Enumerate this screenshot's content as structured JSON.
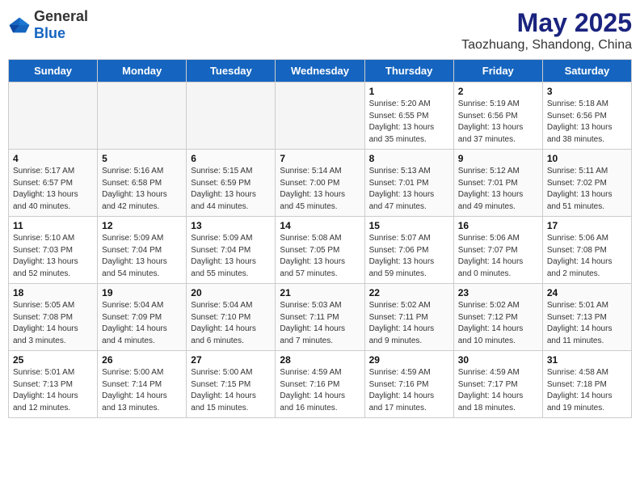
{
  "header": {
    "logo_general": "General",
    "logo_blue": "Blue",
    "title": "May 2025",
    "subtitle": "Taozhuang, Shandong, China"
  },
  "days_of_week": [
    "Sunday",
    "Monday",
    "Tuesday",
    "Wednesday",
    "Thursday",
    "Friday",
    "Saturday"
  ],
  "weeks": [
    [
      {
        "day": "",
        "empty": true
      },
      {
        "day": "",
        "empty": true
      },
      {
        "day": "",
        "empty": true
      },
      {
        "day": "",
        "empty": true
      },
      {
        "day": "1",
        "sunrise": "Sunrise: 5:20 AM",
        "sunset": "Sunset: 6:55 PM",
        "daylight": "Daylight: 13 hours and 35 minutes."
      },
      {
        "day": "2",
        "sunrise": "Sunrise: 5:19 AM",
        "sunset": "Sunset: 6:56 PM",
        "daylight": "Daylight: 13 hours and 37 minutes."
      },
      {
        "day": "3",
        "sunrise": "Sunrise: 5:18 AM",
        "sunset": "Sunset: 6:56 PM",
        "daylight": "Daylight: 13 hours and 38 minutes."
      }
    ],
    [
      {
        "day": "4",
        "sunrise": "Sunrise: 5:17 AM",
        "sunset": "Sunset: 6:57 PM",
        "daylight": "Daylight: 13 hours and 40 minutes."
      },
      {
        "day": "5",
        "sunrise": "Sunrise: 5:16 AM",
        "sunset": "Sunset: 6:58 PM",
        "daylight": "Daylight: 13 hours and 42 minutes."
      },
      {
        "day": "6",
        "sunrise": "Sunrise: 5:15 AM",
        "sunset": "Sunset: 6:59 PM",
        "daylight": "Daylight: 13 hours and 44 minutes."
      },
      {
        "day": "7",
        "sunrise": "Sunrise: 5:14 AM",
        "sunset": "Sunset: 7:00 PM",
        "daylight": "Daylight: 13 hours and 45 minutes."
      },
      {
        "day": "8",
        "sunrise": "Sunrise: 5:13 AM",
        "sunset": "Sunset: 7:01 PM",
        "daylight": "Daylight: 13 hours and 47 minutes."
      },
      {
        "day": "9",
        "sunrise": "Sunrise: 5:12 AM",
        "sunset": "Sunset: 7:01 PM",
        "daylight": "Daylight: 13 hours and 49 minutes."
      },
      {
        "day": "10",
        "sunrise": "Sunrise: 5:11 AM",
        "sunset": "Sunset: 7:02 PM",
        "daylight": "Daylight: 13 hours and 51 minutes."
      }
    ],
    [
      {
        "day": "11",
        "sunrise": "Sunrise: 5:10 AM",
        "sunset": "Sunset: 7:03 PM",
        "daylight": "Daylight: 13 hours and 52 minutes."
      },
      {
        "day": "12",
        "sunrise": "Sunrise: 5:09 AM",
        "sunset": "Sunset: 7:04 PM",
        "daylight": "Daylight: 13 hours and 54 minutes."
      },
      {
        "day": "13",
        "sunrise": "Sunrise: 5:09 AM",
        "sunset": "Sunset: 7:04 PM",
        "daylight": "Daylight: 13 hours and 55 minutes."
      },
      {
        "day": "14",
        "sunrise": "Sunrise: 5:08 AM",
        "sunset": "Sunset: 7:05 PM",
        "daylight": "Daylight: 13 hours and 57 minutes."
      },
      {
        "day": "15",
        "sunrise": "Sunrise: 5:07 AM",
        "sunset": "Sunset: 7:06 PM",
        "daylight": "Daylight: 13 hours and 59 minutes."
      },
      {
        "day": "16",
        "sunrise": "Sunrise: 5:06 AM",
        "sunset": "Sunset: 7:07 PM",
        "daylight": "Daylight: 14 hours and 0 minutes."
      },
      {
        "day": "17",
        "sunrise": "Sunrise: 5:06 AM",
        "sunset": "Sunset: 7:08 PM",
        "daylight": "Daylight: 14 hours and 2 minutes."
      }
    ],
    [
      {
        "day": "18",
        "sunrise": "Sunrise: 5:05 AM",
        "sunset": "Sunset: 7:08 PM",
        "daylight": "Daylight: 14 hours and 3 minutes."
      },
      {
        "day": "19",
        "sunrise": "Sunrise: 5:04 AM",
        "sunset": "Sunset: 7:09 PM",
        "daylight": "Daylight: 14 hours and 4 minutes."
      },
      {
        "day": "20",
        "sunrise": "Sunrise: 5:04 AM",
        "sunset": "Sunset: 7:10 PM",
        "daylight": "Daylight: 14 hours and 6 minutes."
      },
      {
        "day": "21",
        "sunrise": "Sunrise: 5:03 AM",
        "sunset": "Sunset: 7:11 PM",
        "daylight": "Daylight: 14 hours and 7 minutes."
      },
      {
        "day": "22",
        "sunrise": "Sunrise: 5:02 AM",
        "sunset": "Sunset: 7:11 PM",
        "daylight": "Daylight: 14 hours and 9 minutes."
      },
      {
        "day": "23",
        "sunrise": "Sunrise: 5:02 AM",
        "sunset": "Sunset: 7:12 PM",
        "daylight": "Daylight: 14 hours and 10 minutes."
      },
      {
        "day": "24",
        "sunrise": "Sunrise: 5:01 AM",
        "sunset": "Sunset: 7:13 PM",
        "daylight": "Daylight: 14 hours and 11 minutes."
      }
    ],
    [
      {
        "day": "25",
        "sunrise": "Sunrise: 5:01 AM",
        "sunset": "Sunset: 7:13 PM",
        "daylight": "Daylight: 14 hours and 12 minutes."
      },
      {
        "day": "26",
        "sunrise": "Sunrise: 5:00 AM",
        "sunset": "Sunset: 7:14 PM",
        "daylight": "Daylight: 14 hours and 13 minutes."
      },
      {
        "day": "27",
        "sunrise": "Sunrise: 5:00 AM",
        "sunset": "Sunset: 7:15 PM",
        "daylight": "Daylight: 14 hours and 15 minutes."
      },
      {
        "day": "28",
        "sunrise": "Sunrise: 4:59 AM",
        "sunset": "Sunset: 7:16 PM",
        "daylight": "Daylight: 14 hours and 16 minutes."
      },
      {
        "day": "29",
        "sunrise": "Sunrise: 4:59 AM",
        "sunset": "Sunset: 7:16 PM",
        "daylight": "Daylight: 14 hours and 17 minutes."
      },
      {
        "day": "30",
        "sunrise": "Sunrise: 4:59 AM",
        "sunset": "Sunset: 7:17 PM",
        "daylight": "Daylight: 14 hours and 18 minutes."
      },
      {
        "day": "31",
        "sunrise": "Sunrise: 4:58 AM",
        "sunset": "Sunset: 7:18 PM",
        "daylight": "Daylight: 14 hours and 19 minutes."
      }
    ]
  ]
}
